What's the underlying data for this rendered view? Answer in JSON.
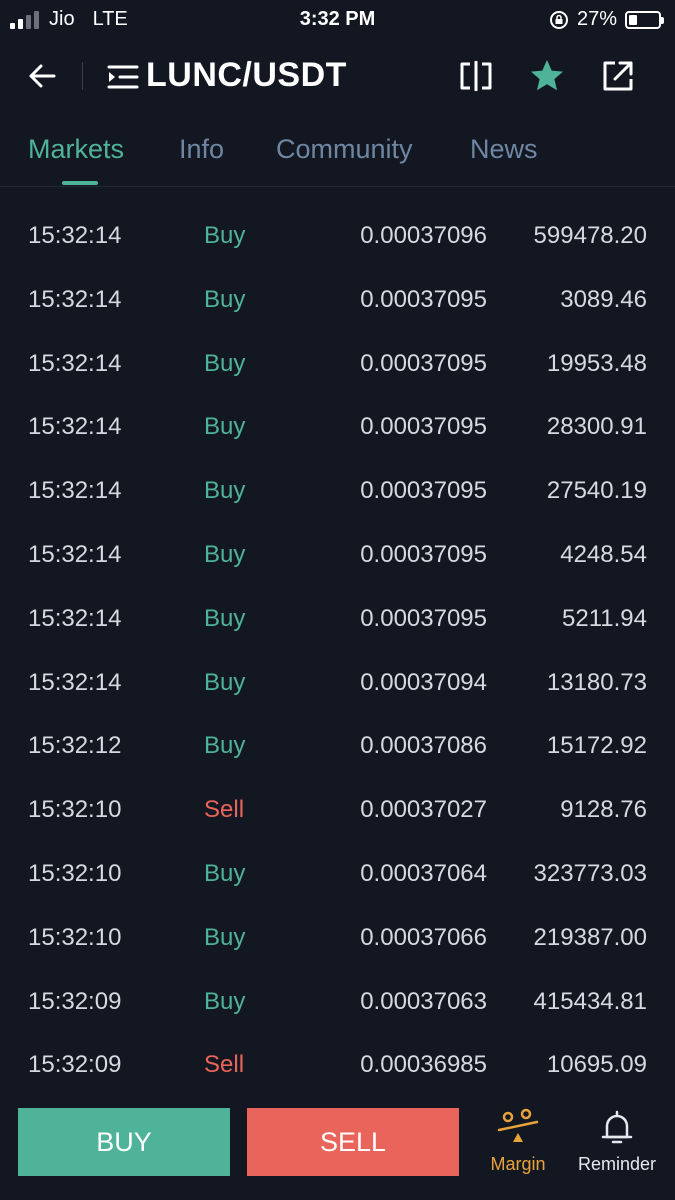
{
  "status_bar": {
    "carrier": "Jio",
    "network": "LTE",
    "time": "3:32 PM",
    "battery_percent_label": "27%",
    "battery_level": 0.27,
    "signal_bars": 4,
    "signal_active": 2
  },
  "header": {
    "pair": "LUNC/USDT",
    "back_icon": "arrow-left-icon",
    "pair_menu_icon": "menu-list-icon",
    "compare_icon": "split-compare-icon",
    "favorite_icon": "star-icon",
    "share_icon": "share-external-icon"
  },
  "tabs": [
    {
      "label": "Markets",
      "active": true
    },
    {
      "label": "Info",
      "active": false
    },
    {
      "label": "Community",
      "active": false
    },
    {
      "label": "News",
      "active": false
    }
  ],
  "trades": [
    {
      "time": "15:32:14",
      "side": "Buy",
      "price": "0.00037096",
      "amount": "599478.20"
    },
    {
      "time": "15:32:14",
      "side": "Buy",
      "price": "0.00037095",
      "amount": "3089.46"
    },
    {
      "time": "15:32:14",
      "side": "Buy",
      "price": "0.00037095",
      "amount": "19953.48"
    },
    {
      "time": "15:32:14",
      "side": "Buy",
      "price": "0.00037095",
      "amount": "28300.91"
    },
    {
      "time": "15:32:14",
      "side": "Buy",
      "price": "0.00037095",
      "amount": "27540.19"
    },
    {
      "time": "15:32:14",
      "side": "Buy",
      "price": "0.00037095",
      "amount": "4248.54"
    },
    {
      "time": "15:32:14",
      "side": "Buy",
      "price": "0.00037095",
      "amount": "5211.94"
    },
    {
      "time": "15:32:14",
      "side": "Buy",
      "price": "0.00037094",
      "amount": "13180.73"
    },
    {
      "time": "15:32:12",
      "side": "Buy",
      "price": "0.00037086",
      "amount": "15172.92"
    },
    {
      "time": "15:32:10",
      "side": "Sell",
      "price": "0.00037027",
      "amount": "9128.76"
    },
    {
      "time": "15:32:10",
      "side": "Buy",
      "price": "0.00037064",
      "amount": "323773.03"
    },
    {
      "time": "15:32:10",
      "side": "Buy",
      "price": "0.00037066",
      "amount": "219387.00"
    },
    {
      "time": "15:32:09",
      "side": "Buy",
      "price": "0.00037063",
      "amount": "415434.81"
    },
    {
      "time": "15:32:09",
      "side": "Sell",
      "price": "0.00036985",
      "amount": "10695.09"
    }
  ],
  "bottom_bar": {
    "buy_label": "BUY",
    "sell_label": "SELL",
    "margin_label": "Margin",
    "margin_icon": "scale-people-icon",
    "reminder_label": "Reminder",
    "reminder_icon": "bell-icon"
  },
  "colors": {
    "background": "#131722",
    "accent_green": "#4fb39a",
    "accent_red": "#e9645a",
    "tab_inactive": "#6f86a3",
    "margin_orange": "#e9a33a"
  }
}
